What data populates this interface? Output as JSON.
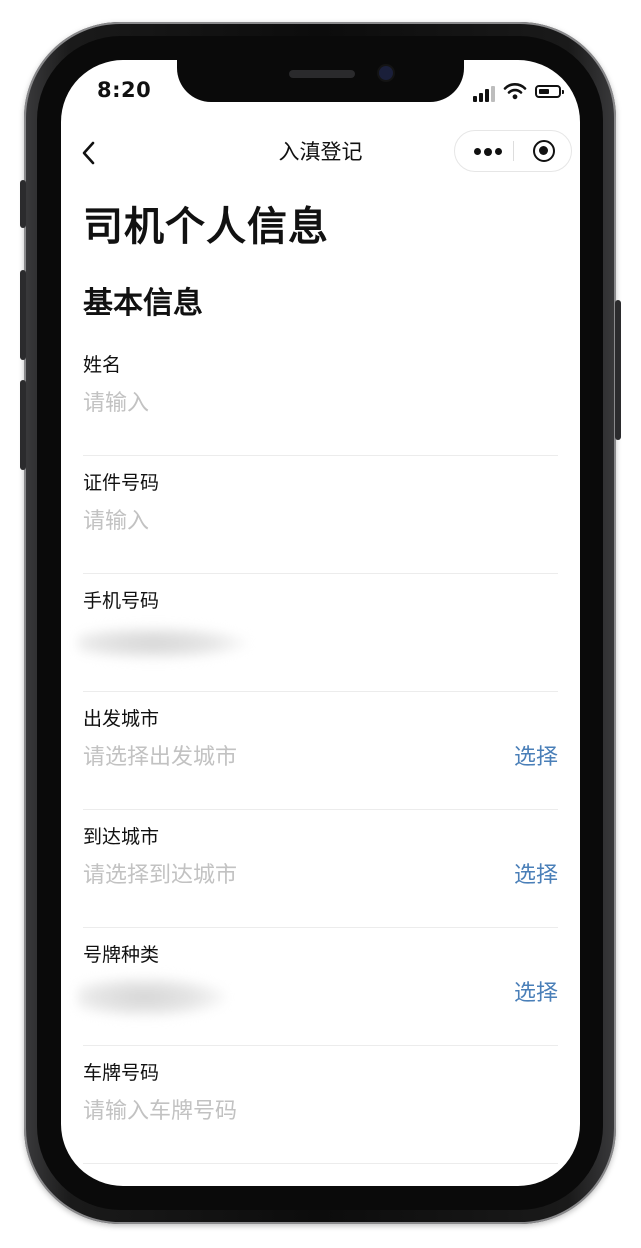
{
  "status_bar": {
    "time": "8:20"
  },
  "nav": {
    "title": "入滇登记"
  },
  "page": {
    "title": "司机个人信息",
    "section": "基本信息"
  },
  "form": {
    "fields": [
      {
        "label": "姓名",
        "placeholder": "请输入"
      },
      {
        "label": "证件号码",
        "placeholder": "请输入"
      },
      {
        "label": "手机号码",
        "placeholder": ""
      },
      {
        "label": "出发城市",
        "placeholder": "请选择出发城市",
        "action": "选择"
      },
      {
        "label": "到达城市",
        "placeholder": "请选择到达城市",
        "action": "选择"
      },
      {
        "label": "号牌种类",
        "placeholder": "",
        "action": "选择"
      },
      {
        "label": "车牌号码",
        "placeholder": "请输入车牌号码"
      }
    ]
  },
  "colors": {
    "accent": "#4a7fb8",
    "placeholder": "#c2c2c2",
    "text": "#111111",
    "divider": "#ececec"
  },
  "icons": [
    "back-chevron-icon",
    "more-dots-icon",
    "close-target-icon",
    "signal-icon",
    "wifi-icon",
    "battery-icon"
  ]
}
